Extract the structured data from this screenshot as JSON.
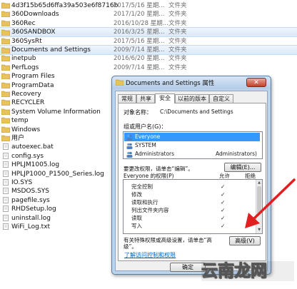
{
  "files": [
    {
      "name": "4d3f15b65d6ffa39a503e6f8716b",
      "date": "2017/5/16 星期...",
      "type": "文件夹",
      "selected": false
    },
    {
      "name": "360Downloads",
      "date": "2017/1/20 星期...",
      "type": "文件夹",
      "selected": false
    },
    {
      "name": "360Rec",
      "date": "2016/10/28 星期...",
      "type": "文件夹",
      "selected": false
    },
    {
      "name": "360SANDBOX",
      "date": "2016/3/25 星期...",
      "type": "文件夹",
      "selected": true
    },
    {
      "name": "360SysRt",
      "date": "2017/5/16 星期...",
      "type": "文件夹",
      "selected": false
    },
    {
      "name": "Documents and Settings",
      "date": "2009/7/14 星期...",
      "type": "文件夹",
      "selected": true
    },
    {
      "name": "inetpub",
      "date": "2016/6/20 星期...",
      "type": "文件夹",
      "selected": false
    },
    {
      "name": "PerfLogs",
      "date": "2009/7/14 星期...",
      "type": "文件夹",
      "selected": false
    },
    {
      "name": "Program Files",
      "date": "",
      "type": "",
      "selected": false
    },
    {
      "name": "ProgramData",
      "date": "",
      "type": "",
      "selected": false
    },
    {
      "name": "Recovery",
      "date": "",
      "type": "",
      "selected": false
    },
    {
      "name": "RECYCLER",
      "date": "",
      "type": "",
      "selected": false
    },
    {
      "name": "System Volume Information",
      "date": "",
      "type": "",
      "selected": false
    },
    {
      "name": "temp",
      "date": "",
      "type": "",
      "selected": false
    },
    {
      "name": "Windows",
      "date": "",
      "type": "",
      "selected": false
    },
    {
      "name": "用户",
      "date": "",
      "type": "",
      "selected": false
    },
    {
      "name": "autoexec.bat",
      "date": "",
      "type": "",
      "selected": false
    },
    {
      "name": "config.sys",
      "date": "",
      "type": "",
      "selected": false
    },
    {
      "name": "HPLJM1005.log",
      "date": "",
      "type": "",
      "selected": false
    },
    {
      "name": "HPLJP1000_P1500_Series.log",
      "date": "",
      "type": "",
      "selected": false
    },
    {
      "name": "IO.SYS",
      "date": "",
      "type": "",
      "selected": false
    },
    {
      "name": "MSDOS.SYS",
      "date": "",
      "type": "",
      "selected": false
    },
    {
      "name": "pagefile.sys",
      "date": "",
      "type": "",
      "selected": false
    },
    {
      "name": "RHDSetup.log",
      "date": "",
      "type": "",
      "selected": false
    },
    {
      "name": "uninstall.log",
      "date": "",
      "type": "",
      "selected": false
    },
    {
      "name": "WiFi_Log.txt",
      "date": "",
      "type": "",
      "selected": false
    }
  ],
  "dialog": {
    "title": "Documents and Settings 属性",
    "close_label": "✕",
    "tabs": [
      "常规",
      "共享",
      "安全",
      "以前的版本",
      "自定义"
    ],
    "active_tab": 2,
    "object_label": "对象名称：",
    "object_value": "C:\\Documents and Settings",
    "group_label": "组或用户名(G)：",
    "users": [
      {
        "name": "Everyone",
        "note": "",
        "selected": true
      },
      {
        "name": "SYSTEM",
        "note": "",
        "selected": false
      },
      {
        "name": "Administrators",
        "note": "Administrators)",
        "selected": false
      }
    ],
    "change_text": "要更改权限，请单击“编辑”。",
    "edit_button": "编辑(E)...",
    "perm_header": "Everyone 的权限(P)",
    "allow_header": "允许",
    "deny_header": "拒绝",
    "permissions": [
      {
        "name": "完全控制",
        "allow": "✓"
      },
      {
        "name": "修改",
        "allow": "✓"
      },
      {
        "name": "读取和执行",
        "allow": "✓"
      },
      {
        "name": "列出文件夹内容",
        "allow": "✓"
      },
      {
        "name": "读取",
        "allow": "✓"
      },
      {
        "name": "写入",
        "allow": "✓"
      }
    ],
    "special_text_1": "有关特殊权限或高级设置，请单击“高",
    "special_text_2": "级”。",
    "advanced_button": "高级(V)",
    "link_text": "了解访问控制和权限",
    "ok_button": "确定"
  },
  "watermark": "云南龙网",
  "colors": {
    "selection": "#3399ff",
    "row_selected": "#dbe9f8",
    "folder": "#e8c25c",
    "dialog_frame": "#bcd3ec",
    "arrow": "#e02020"
  }
}
